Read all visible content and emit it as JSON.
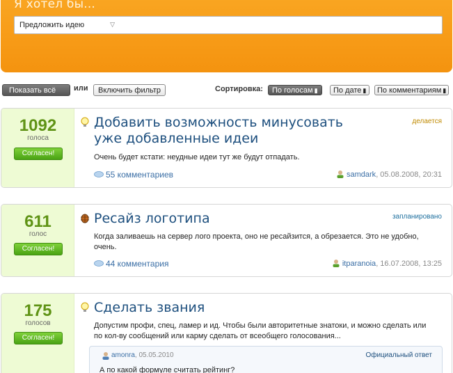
{
  "header": {
    "title": "Я хотел бы...",
    "select_value": "Предложить идею",
    "input_value": ""
  },
  "filters": {
    "show_all": "Показать всё",
    "or": "или",
    "enable_filter": "Включить фильтр",
    "sort_label": "Сортировка:",
    "sort_by_votes": "По голосам",
    "sort_by_date": "По дате",
    "sort_by_comments": "По комментариям"
  },
  "ideas": [
    {
      "votes": "1092",
      "votes_label": "голоса",
      "agree": "Согласен!",
      "icon": "lightbulb-icon",
      "title": "Добавить возможность минусовать уже добавленные идеи",
      "status": "делается",
      "status_color": "#c08a00",
      "description": "Очень будет кстати: неудные идеи тут же будут отпадать.",
      "comments": "55 комментариев",
      "author": "samdark",
      "date": ", 05.08.2008, 20:31"
    },
    {
      "votes": "611",
      "votes_label": "голос",
      "agree": "Согласен!",
      "icon": "bug-icon",
      "title": "Ресайз логотипа",
      "status": "запланировано",
      "status_color": "#1d6f9e",
      "description": "Когда заливаешь на сервер лого проекта, оно не ресайзится, а обрезается. Это не удобно, очень.",
      "comments": "44 комментария",
      "author": "itparanoia",
      "date": ", 16.07.2008, 13:25"
    },
    {
      "votes": "175",
      "votes_label": "голосов",
      "agree": "Согласен!",
      "icon": "lightbulb-icon",
      "title": "Сделать звания",
      "status": "",
      "description": "Допустим профи, спец, ламер и ид. Чтобы были авторитетные знатоки, и можно сделать или по кол-ву сообщений или карму сделать от всеобщего голосования...",
      "official": {
        "author": "amonra",
        "date": ", 05.05.2010",
        "label": "Официальный ответ",
        "text": "А по какой формуле считать рейтинг?"
      }
    }
  ]
}
